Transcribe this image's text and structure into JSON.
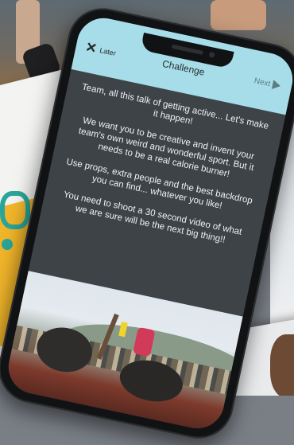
{
  "header": {
    "later_label": "Later",
    "title": "Challenge",
    "next_label": "Next"
  },
  "message": {
    "paragraphs": [
      "Team, all this talk of getting active... Let's make it happen!",
      "We want you to be creative and invent your team's own weird and wonderful sport. But it needs to be a real calorie burner!",
      "Use props, extra people and the best backdrop you can find... whatever you like!",
      "You need to shoot a 30 second video of what we are sure will be the next big thing!!"
    ]
  },
  "icons": {
    "later": "close-icon",
    "next": "arrow-right-icon"
  },
  "colors": {
    "topbar": "#a6dde8",
    "panel": "#3d4347",
    "next": "#5c7c86"
  }
}
